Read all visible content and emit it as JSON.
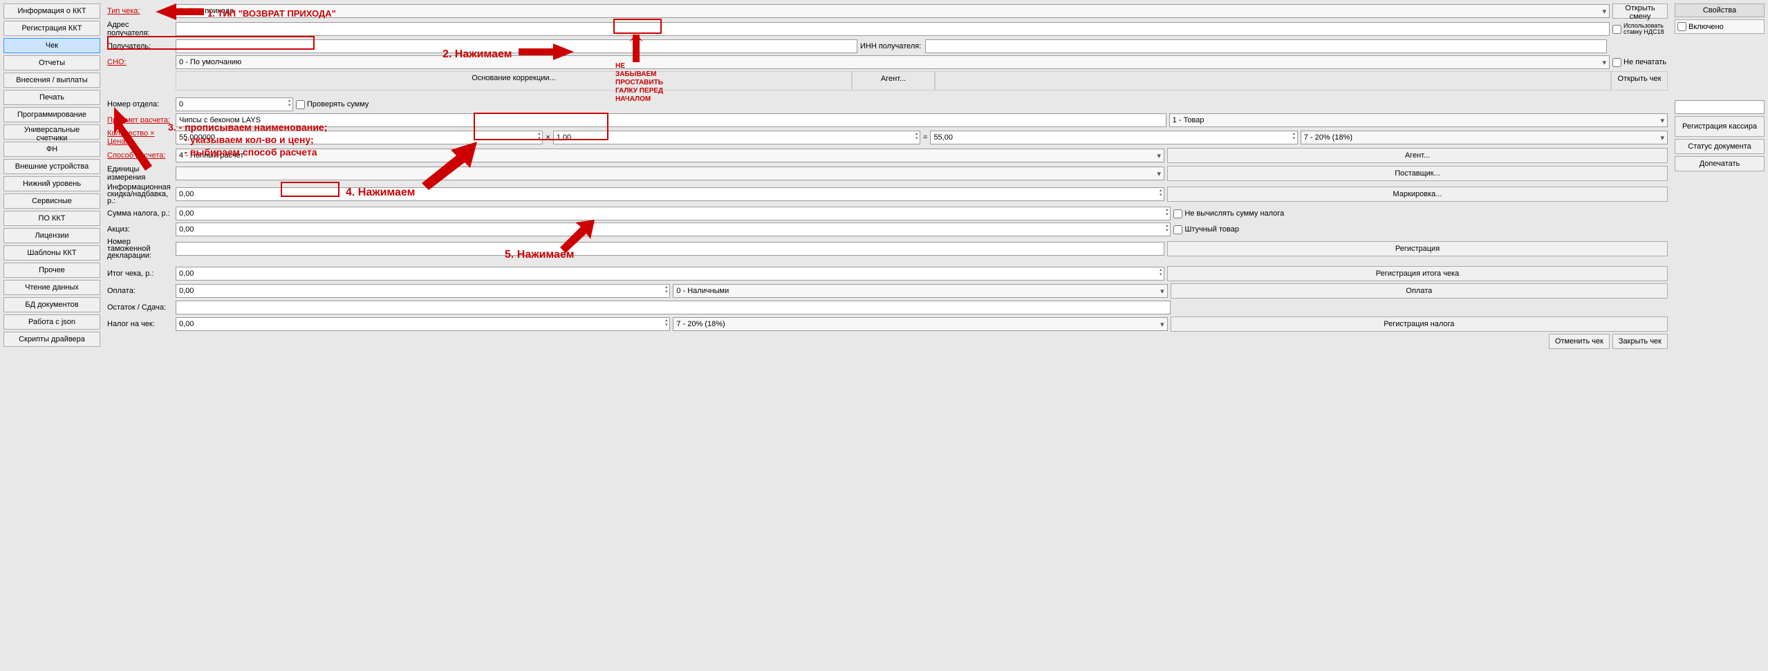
{
  "sidebar": {
    "items": [
      {
        "label": "Информация о ККТ"
      },
      {
        "label": "Регистрация ККТ"
      },
      {
        "label": "Чек",
        "active": true
      },
      {
        "label": "Отчеты"
      },
      {
        "label": "Внесения / выплаты"
      },
      {
        "label": "Печать"
      },
      {
        "label": "Программирование"
      },
      {
        "label": "Универсальные счетчики"
      },
      {
        "label": "ФН"
      },
      {
        "label": "Внешние устройства"
      },
      {
        "label": "Нижний уровень"
      },
      {
        "label": "Сервисные"
      },
      {
        "label": "ПО ККТ"
      },
      {
        "label": "Лицензии"
      },
      {
        "label": "Шаблоны ККТ"
      },
      {
        "label": "Прочее"
      },
      {
        "label": "Чтение данных"
      },
      {
        "label": "БД документов"
      },
      {
        "label": "Работа с json"
      },
      {
        "label": "Скрипты драйвера"
      }
    ]
  },
  "right": {
    "header": "Свойства",
    "enabled": "Включено",
    "reg": "Регистрация кассира",
    "doc_status": "Статус документа",
    "reprint": "Допечатать"
  },
  "main": {
    "check_type_lbl": "Тип чека:",
    "check_type": "1 - Чек прихода",
    "open_shift": "Открыть смену",
    "recipient_addr": "Адрес получателя:",
    "recipient": "Получатель:",
    "inn_lbl": "ИНН получателя:",
    "use_vat18": "Использовать ставку НДС18",
    "sno_lbl": "СНО:",
    "sno": "0 - По умолчанию",
    "no_print": "Не печатать",
    "correction": "Основание коррекции...",
    "agent": "Агент...",
    "open_check": "Открыть чек",
    "dept_no_lbl": "Номер отдела:",
    "dept_no": "0",
    "verify_sum": "Проверять сумму",
    "subject_lbl": "Предмет расчета:",
    "subject": "Чипсы с беконом LAYS",
    "subject_type": "1 - Товар",
    "qty_price_lbl": "Количество × Цена:",
    "qty": "55,000000",
    "x": "×",
    "price": "1,00",
    "eq": "=",
    "total": "55,00",
    "tax": "7 - 20% (18%)",
    "method_lbl": "Способ расчета:",
    "method": "4 - Полный расчет",
    "agent_btn": "Агент...",
    "units_lbl": "Единицы измерения",
    "supplier": "Поставщик...",
    "info_discount_lbl": "Информационная скидка/надбавка, р.:",
    "info_discount": "0,00",
    "marking": "Маркировка...",
    "tax_sum_lbl": "Сумма налога, р.:",
    "tax_sum": "0,00",
    "no_calc_tax": "Не вычислять сумму налога",
    "excise_lbl": "Акциз:",
    "excise": "0,00",
    "piece_goods": "Штучный товар",
    "customs_lbl": "Номер таможенной декларации:",
    "registration": "Регистрация",
    "check_total_lbl": "Итог чека, р.:",
    "check_total": "0,00",
    "reg_check_total": "Регистрация итога чека",
    "payment_lbl": "Оплата:",
    "payment": "0,00",
    "payment_type": "0 - Наличными",
    "payment_btn": "Оплата",
    "change_lbl": "Остаток / Сдача:",
    "check_tax_lbl": "Налог на чек:",
    "check_tax": "0,00",
    "check_tax_type": "7 - 20% (18%)",
    "reg_tax": "Регистрация налога",
    "cancel_check": "Отменить чек",
    "close_check": "Закрыть чек"
  },
  "annotations": {
    "a1": "1. ТИП \"ВОЗВРАТ ПРИХОДА\"",
    "a2": "2. Нажимаем",
    "a3": "3. - прописываем наименование;\n      - указываем кол-во и цену;\n      - выбираем способ расчета",
    "a4": "4. Нажимаем",
    "a5": "5. Нажимаем",
    "a6": "НЕ ЗАБЫВАЕМ ПРОСТАВИТЬ ГАЛКУ ПЕРЕД НАЧАЛОМ"
  }
}
